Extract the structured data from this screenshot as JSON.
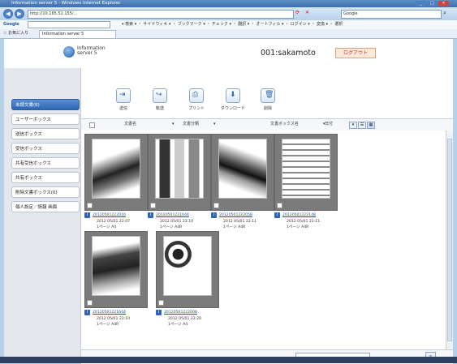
{
  "browser": {
    "title": "Information server 5 - Windows Internet Explorer",
    "url": "http://10.165.52.155/...",
    "search_engine": "Google",
    "google_label": "Google",
    "favorites_label": "お気に入り",
    "tab_label": "Information server 5",
    "google_toolbar": "▾ 検索 ▾ ・ サイドウィキ ▾ ・ ブックマーク ▾ ・ チェック ▾ ・ 翻訳 ▾ ・ オートフィル ▾ ・ ログイン ▾ ・ 変換 ▾ ・ 選択"
  },
  "header": {
    "app_name_line1": "Information",
    "app_name_line2": "server 5",
    "user": "001:sakamoto",
    "logout_label": "ログアウト"
  },
  "sidebar": {
    "items": [
      {
        "label": "未読文書(6)",
        "active": true
      },
      {
        "label": "ユーザーボックス"
      },
      {
        "label": "送信ボックス"
      },
      {
        "label": "受信ボックス"
      },
      {
        "label": "共有受信ボックス"
      },
      {
        "label": "共有ボックス"
      },
      {
        "label": "削除文書ボックス(0)"
      },
      {
        "label": "個人設定／情報 画面"
      }
    ]
  },
  "toolbar": {
    "send": "送信",
    "forward": "転送",
    "print": "プリント",
    "download": "ダウンロード",
    "delete": "削除"
  },
  "sortbar": {
    "sort1": "文書名",
    "sort2": "文書分類",
    "sort3": "文書ボックス名",
    "sort4": "日付"
  },
  "documents": [
    {
      "name": "20120501222016",
      "date": "2012 05/01 22:07",
      "pages": "1ページ A4"
    },
    {
      "name": "20120501221644",
      "date": "2012 05/01 22:10",
      "pages": "1ページ A4R"
    },
    {
      "name": "20120501222058",
      "date": "2012 05/01 22:11",
      "pages": "1ページ A4R"
    },
    {
      "name": "20120501222148",
      "date": "2012 05/01 22:11",
      "pages": "1ページ A4R"
    },
    {
      "name": "20120501221644",
      "date": "2012 05/01 22:10",
      "pages": "1ページ A4R"
    },
    {
      "name": "20120501222006",
      "date": "2012 05/01 22:20",
      "pages": "1ページ A4"
    }
  ],
  "colors": {
    "accent": "#2f66b3",
    "logout": "#c0392b"
  }
}
